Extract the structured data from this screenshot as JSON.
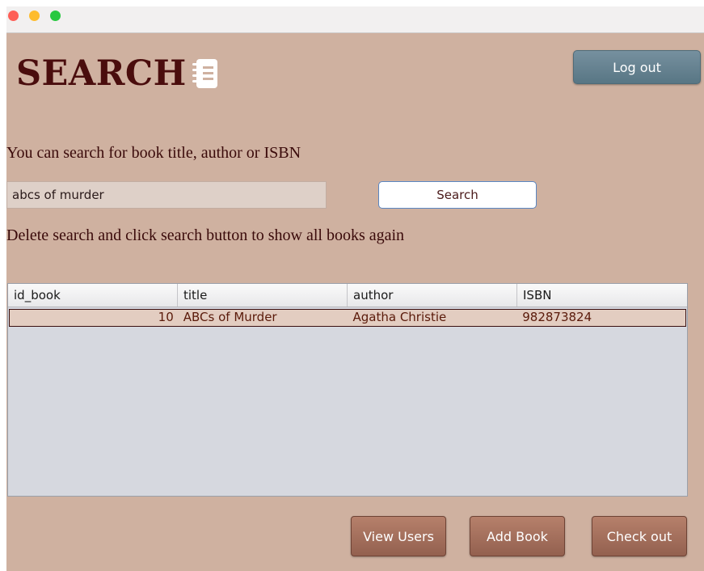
{
  "titlebar": {
    "buttons": [
      "close",
      "minimize",
      "maximize"
    ]
  },
  "header": {
    "title": "SEARCH",
    "icon": "notebook-icon",
    "logout_label": "Log out"
  },
  "search": {
    "hint": "You can search for book title, author or ISBN",
    "input_value": "abcs of murder",
    "button_label": "Search",
    "reset_hint": "Delete search and click search button to show all books again"
  },
  "table": {
    "columns": [
      "id_book",
      "title",
      "author",
      "ISBN"
    ],
    "rows": [
      {
        "id_book": "10",
        "title": "ABCs of Murder",
        "author": "Agatha Christie",
        "isbn": "982873824"
      }
    ]
  },
  "actions": {
    "view_users": "View Users",
    "add_book": "Add Book",
    "check_out": "Check out"
  },
  "colors": {
    "background": "#cfb1a0",
    "title": "#4a0d0d",
    "logout_button": "#6a8492",
    "action_button": "#a5705d",
    "selected_row": "#e3cdc1"
  }
}
